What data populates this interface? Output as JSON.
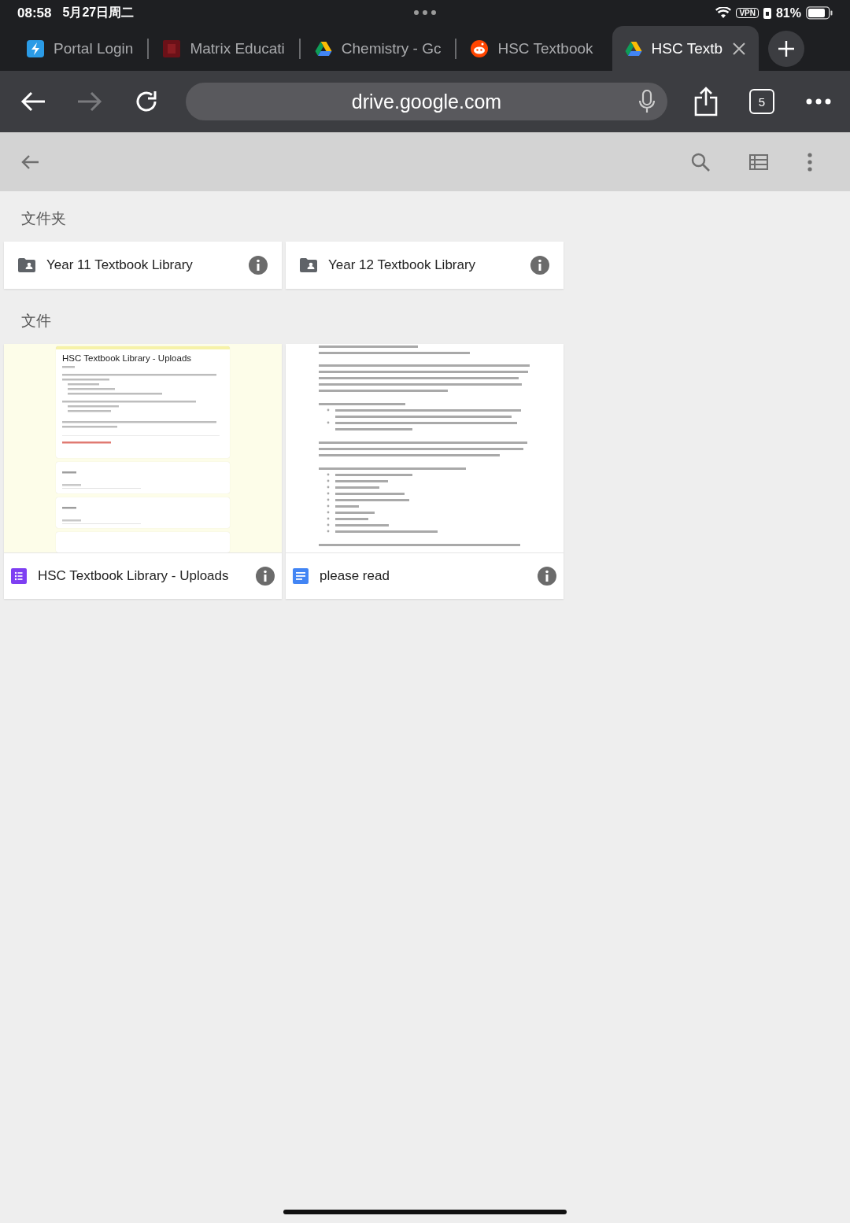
{
  "status_bar": {
    "time": "08:58",
    "date": "5月27日周二",
    "vpn": "VPN",
    "battery": "81%"
  },
  "tabs": [
    {
      "title": "Portal Login",
      "kind": "portal",
      "selected": false
    },
    {
      "title": "Matrix Educati",
      "kind": "matrix",
      "selected": false
    },
    {
      "title": "Chemistry - Gc",
      "kind": "drive",
      "selected": false
    },
    {
      "title": "HSC Textbook",
      "kind": "reddit",
      "selected": false
    },
    {
      "title": "HSC Textb",
      "kind": "drive",
      "selected": true
    }
  ],
  "toolbar": {
    "url": "drive.google.com",
    "tab_count": "5",
    "forward_disabled": true
  },
  "sections": [
    {
      "heading": "文件夹",
      "kind": "folders",
      "items": [
        {
          "name": "Year 11 Textbook Library"
        },
        {
          "name": "Year 12 Textbook Library"
        }
      ]
    },
    {
      "heading": "文件",
      "kind": "files",
      "items": [
        {
          "name": "HSC Textbook Library - Uploads",
          "kind": "form",
          "preview": {
            "title": "HSC Textbook Library - Uploads"
          }
        },
        {
          "name": "please read",
          "kind": "doc"
        }
      ]
    }
  ]
}
